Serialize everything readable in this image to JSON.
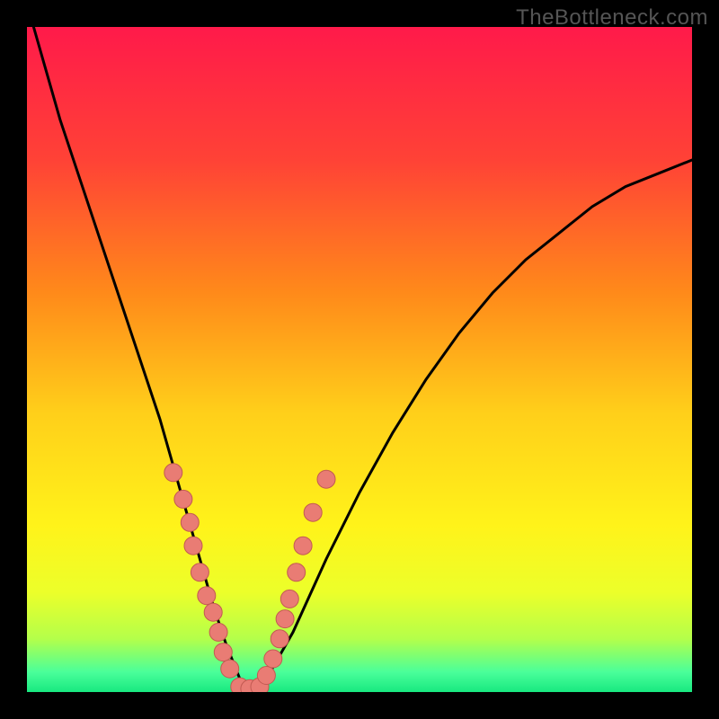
{
  "watermark": "TheBottleneck.com",
  "colors": {
    "gradient_stops": [
      {
        "offset": 0.0,
        "color": "#ff1a4a"
      },
      {
        "offset": 0.2,
        "color": "#ff4236"
      },
      {
        "offset": 0.4,
        "color": "#ff8a1a"
      },
      {
        "offset": 0.58,
        "color": "#ffcf1a"
      },
      {
        "offset": 0.75,
        "color": "#fff31a"
      },
      {
        "offset": 0.85,
        "color": "#ecff2a"
      },
      {
        "offset": 0.92,
        "color": "#b4ff4a"
      },
      {
        "offset": 0.97,
        "color": "#4aff9a"
      },
      {
        "offset": 1.0,
        "color": "#18e880"
      }
    ],
    "curve": "#000000",
    "dot_fill": "#e97c74",
    "dot_stroke": "#c25a52"
  },
  "chart_data": {
    "type": "line",
    "title": "",
    "xlabel": "",
    "ylabel": "",
    "xlim": [
      0,
      100
    ],
    "ylim": [
      0,
      100
    ],
    "series": [
      {
        "name": "bottleneck-curve",
        "x": [
          1,
          3,
          5,
          8,
          11,
          14,
          17,
          20,
          22,
          24,
          26,
          28,
          30,
          32,
          34,
          36,
          40,
          45,
          50,
          55,
          60,
          65,
          70,
          75,
          80,
          85,
          90,
          95,
          100
        ],
        "values": [
          100,
          93,
          86,
          77,
          68,
          59,
          50,
          41,
          34,
          27,
          20,
          13,
          7,
          2,
          0,
          2,
          9,
          20,
          30,
          39,
          47,
          54,
          60,
          65,
          69,
          73,
          76,
          78,
          80
        ]
      }
    ],
    "dots": {
      "name": "sample-points",
      "x": [
        22.0,
        23.5,
        24.5,
        25.0,
        26.0,
        27.0,
        28.0,
        28.8,
        29.5,
        30.5,
        32.0,
        33.5,
        35.0,
        36.0,
        37.0,
        38.0,
        38.8,
        39.5,
        40.5,
        41.5,
        43.0,
        45.0
      ],
      "values": [
        33.0,
        29.0,
        25.5,
        22.0,
        18.0,
        14.5,
        12.0,
        9.0,
        6.0,
        3.5,
        0.8,
        0.5,
        0.8,
        2.5,
        5.0,
        8.0,
        11.0,
        14.0,
        18.0,
        22.0,
        27.0,
        32.0
      ]
    }
  }
}
